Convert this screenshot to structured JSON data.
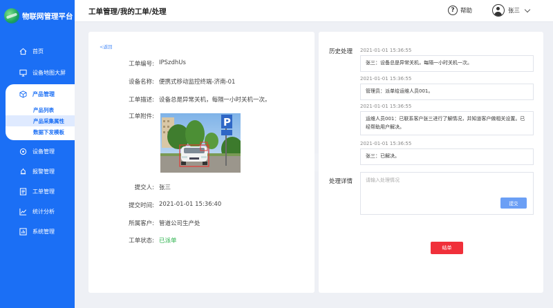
{
  "app": {
    "title": "物联网管理平台"
  },
  "sidebar": {
    "items": [
      {
        "label": "首页",
        "icon": "home-icon"
      },
      {
        "label": "设备地图大屏",
        "icon": "screen-icon"
      },
      {
        "label": "产品管理",
        "icon": "cube-icon"
      },
      {
        "label": "设备管理",
        "icon": "device-icon"
      },
      {
        "label": "报警管理",
        "icon": "alarm-icon"
      },
      {
        "label": "工单管理",
        "icon": "ticket-icon"
      },
      {
        "label": "统计分析",
        "icon": "chart-icon"
      },
      {
        "label": "系统管理",
        "icon": "system-icon"
      }
    ],
    "sub_items": [
      {
        "label": "产品列表"
      },
      {
        "label": "产品采集属性"
      },
      {
        "label": "数据下发模板"
      }
    ]
  },
  "header": {
    "breadcrumb": "工单管理/我的工单/处理",
    "help": "帮助",
    "user": "张三"
  },
  "detail": {
    "back": "<返回",
    "fields": [
      {
        "label": "工单编号:",
        "value": "IPSzdhUs"
      },
      {
        "label": "设备名称:",
        "value": "便携式移动监控终端-济南-01"
      },
      {
        "label": "工单描述:",
        "value": "设备总是异常关机，每隔一小时关机一次。"
      },
      {
        "label": "工单附件:",
        "value": ""
      },
      {
        "label": "提交人:",
        "value": "张三"
      },
      {
        "label": "提交时间:",
        "value": "2021-01-01 15:36:40"
      },
      {
        "label": "所属客户:",
        "value": "管道公司生产处"
      },
      {
        "label": "工单状态:",
        "value": "已派单"
      }
    ]
  },
  "process": {
    "history_label": "历史处理",
    "history": [
      {
        "time": "2021-01-01 15:36:55",
        "text": "张三：设备总是异常关机，每隔一小时关机一次。"
      },
      {
        "time": "2021-01-01 15:36:55",
        "text": "管理员：派单给运维人员001。"
      },
      {
        "time": "2021-01-01 15:36:55",
        "text": "运维人员001：已联系客户张三进行了解情况，并知道客户做相关设置。已经帮助用户解决。"
      },
      {
        "time": "2021-01-01 15:36:55",
        "text": "张三：已解决。"
      }
    ],
    "detail_label": "处理详情",
    "placeholder": "请输入处理情况",
    "submit": "提交",
    "close": "结单"
  },
  "colors": {
    "primary": "#1b6ff5",
    "status_green": "#2bb24c",
    "danger": "#f0303a"
  }
}
